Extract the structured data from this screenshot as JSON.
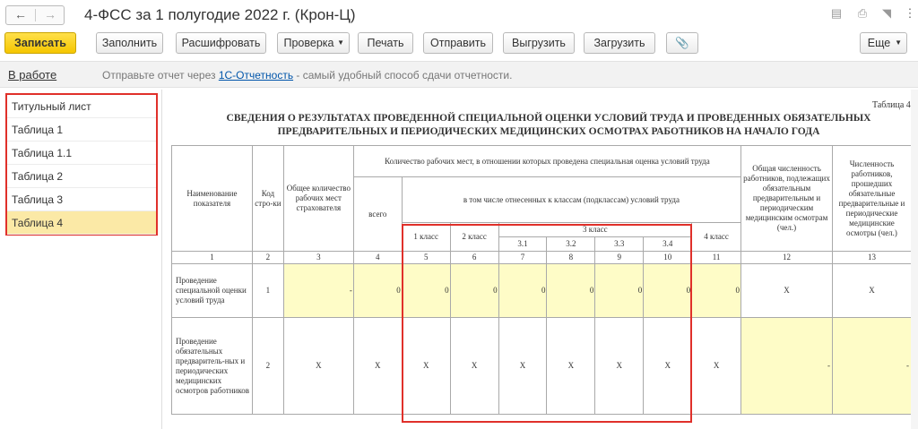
{
  "window": {
    "title": "4-ФСС за 1 полугодие 2022 г. (Крон-Ц)",
    "back_icon": "arrow-left",
    "forward_icon": "arrow-right",
    "right_icons": [
      "save-icon",
      "print-icon",
      "preview-icon",
      "more-vertical-icon"
    ]
  },
  "toolbar": {
    "save": "Записать",
    "fill": "Заполнить",
    "decode": "Расшифровать",
    "check": "Проверка",
    "print": "Печать",
    "send": "Отправить",
    "export": "Выгрузить",
    "import": "Загрузить",
    "attach_icon": "paperclip-icon",
    "more": "Еще"
  },
  "status": {
    "state": "В работе",
    "hint_prefix": "Отправьте отчет через ",
    "hint_link": "1С-Отчетность",
    "hint_suffix": " - самый удобный способ сдачи отчетности."
  },
  "sidebar": {
    "items": [
      {
        "label": "Титульный лист"
      },
      {
        "label": "Таблица 1"
      },
      {
        "label": "Таблица 1.1"
      },
      {
        "label": "Таблица 2"
      },
      {
        "label": "Таблица 3"
      },
      {
        "label": "Таблица 4"
      }
    ],
    "active_index": 5
  },
  "report": {
    "table_no": "Таблица 4",
    "heading_line1": "СВЕДЕНИЯ  О РЕЗУЛЬТАТАХ ПРОВЕДЕННОЙ СПЕЦИАЛЬНОЙ ОЦЕНКИ УСЛОВИЙ ТРУДА И ПРОВЕДЕННЫХ ОБЯЗАТЕЛЬНЫХ",
    "heading_line2": "ПРЕДВАРИТЕЛЬНЫХ И ПЕРИОДИЧЕСКИХ МЕДИЦИНСКИХ ОСМОТРАХ РАБОТНИКОВ НА НАЧАЛО ГОДА",
    "headers": {
      "name": "Наименование показателя",
      "code": "Код стро-ки",
      "total_places": "Общее количество рабочих мест страхователя",
      "assessed": "Количество рабочих мест, в отношении которых проведена специальная оценка условий труда",
      "all": "всего",
      "incl_classes": "в том числе отнесенных к классам (подклассам) условий труда",
      "class1": "1 класс",
      "class2": "2 класс",
      "class3": "3 класс",
      "sub31": "3.1",
      "sub32": "3.2",
      "sub33": "3.3",
      "sub34": "3.4",
      "class4": "4 класс",
      "subject_count": "Общая численность работников, подлежащих обязательным предварительным и периодическим медицинским осмотрам (чел.)",
      "passed_count": "Численность работников, прошедших обязательные предварительные и периодические медицинские осмотры (чел.)"
    },
    "col_numbers": [
      "1",
      "2",
      "3",
      "4",
      "5",
      "6",
      "7",
      "8",
      "9",
      "10",
      "11",
      "12",
      "13"
    ],
    "rows": [
      {
        "name": "Проведение специальной оценки условий труда",
        "code": "1",
        "total": "-",
        "all": "0",
        "c1": "0",
        "c2": "0",
        "c31": "0",
        "c32": "0",
        "c33": "0",
        "c34": "0",
        "c4": "0",
        "subject": "Х",
        "passed": "Х"
      },
      {
        "name": "Проведение обязательных предваритель-ных и периодических медицинских осмотров работников",
        "code": "2",
        "total": "Х",
        "all": "Х",
        "c1": "Х",
        "c2": "Х",
        "c31": "Х",
        "c32": "Х",
        "c33": "Х",
        "c34": "Х",
        "c4": "Х",
        "subject": "-",
        "passed": "-"
      }
    ]
  }
}
